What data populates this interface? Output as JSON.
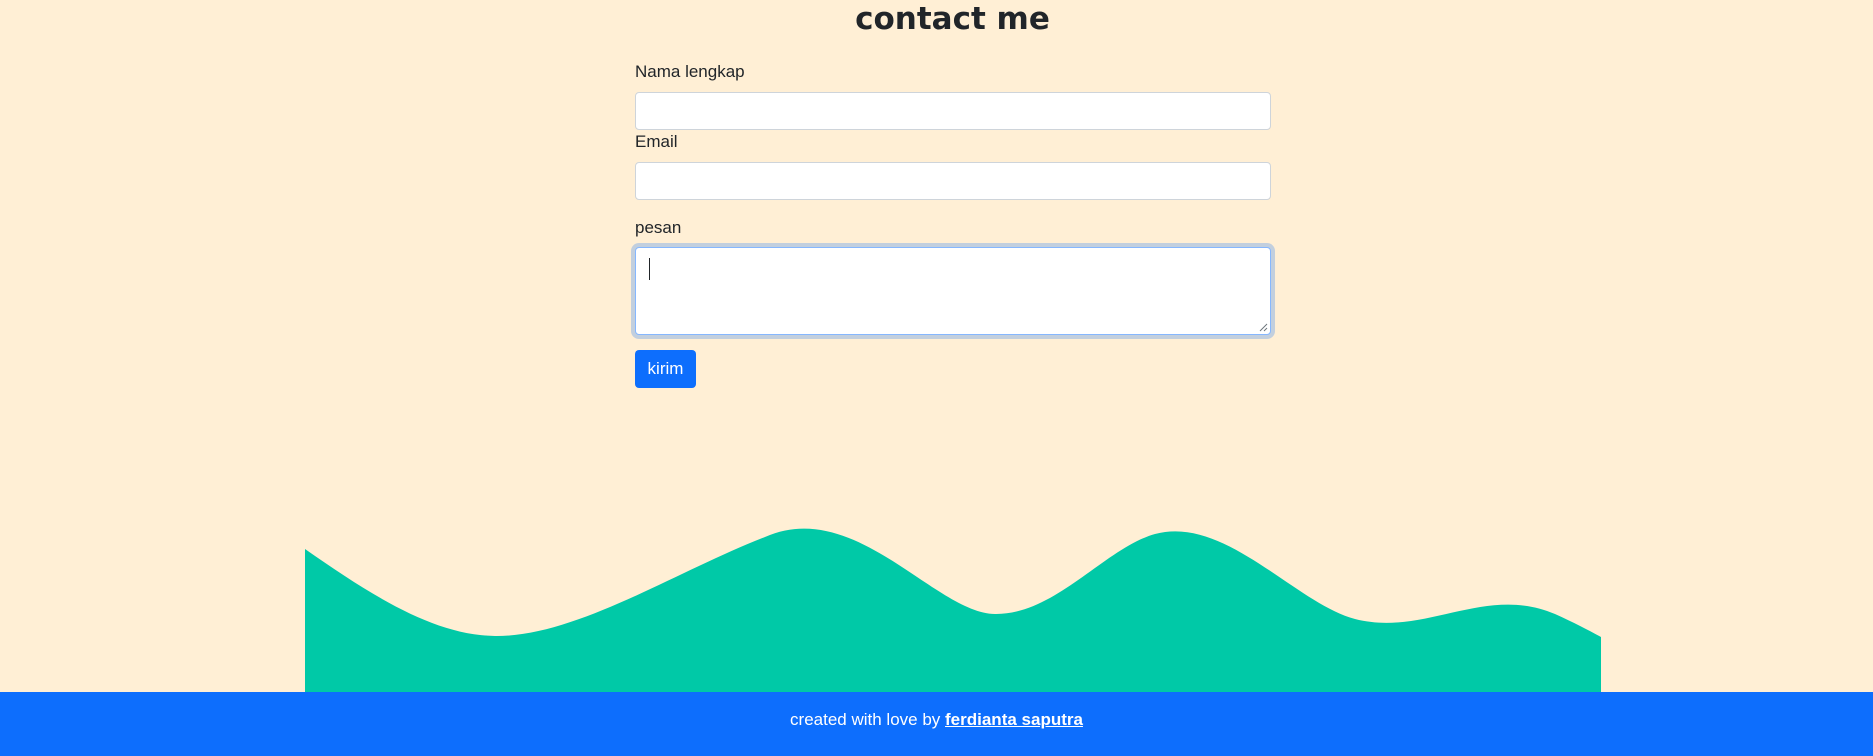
{
  "page": {
    "title": "contact me"
  },
  "form": {
    "name_label": "Nama lengkap",
    "name_value": "",
    "email_label": "Email",
    "email_value": "",
    "message_label": "pesan",
    "message_value": "",
    "submit_label": "kirim"
  },
  "footer": {
    "text": "created with love by",
    "author_link": "ferdianta saputra"
  },
  "colors": {
    "background": "#ffefd5",
    "wave": "#00c9a7",
    "primary": "#0d6efd"
  },
  "icons": {
    "resize_grip": "resize-grip-icon"
  }
}
